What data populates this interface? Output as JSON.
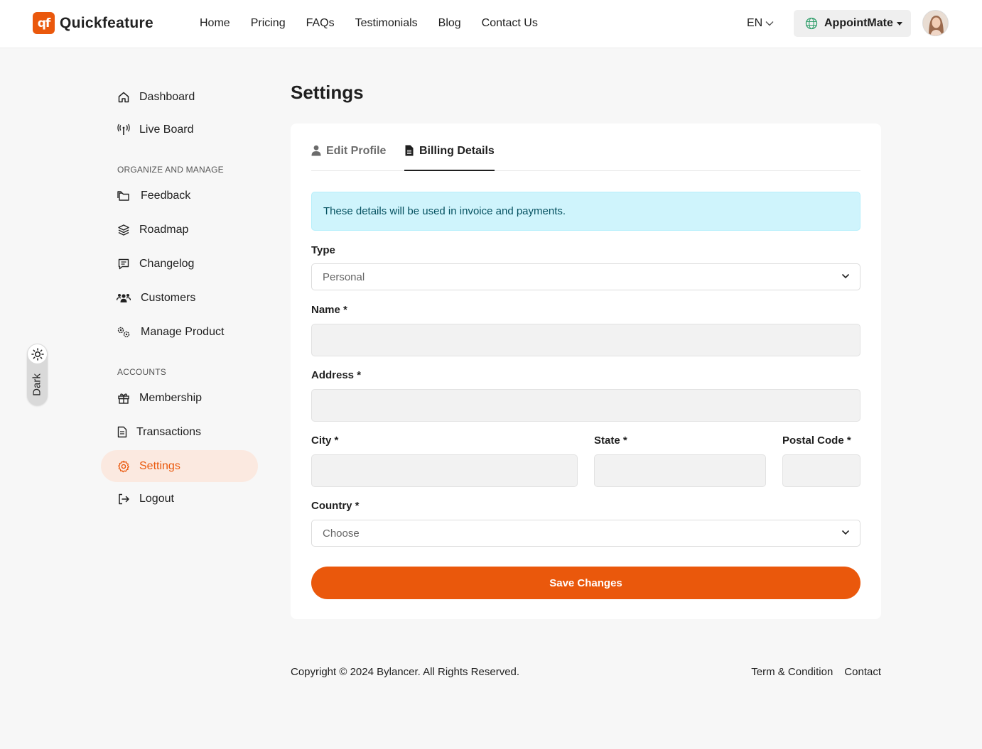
{
  "brand": {
    "logo_mark": "qf",
    "name": "Quickfeature",
    "accent": "#ea580c"
  },
  "nav": [
    "Home",
    "Pricing",
    "FAQs",
    "Testimonials",
    "Blog",
    "Contact Us"
  ],
  "header": {
    "language": "EN",
    "workspace": "AppointMate"
  },
  "sidebar": {
    "top_items": [
      {
        "label": "Dashboard",
        "icon": "home-icon"
      },
      {
        "label": "Live Board",
        "icon": "broadcast-icon"
      }
    ],
    "section_manage": "ORGANIZE AND MANAGE",
    "manage_items": [
      {
        "label": "Feedback",
        "icon": "folders-icon"
      },
      {
        "label": "Roadmap",
        "icon": "layers-icon"
      },
      {
        "label": "Changelog",
        "icon": "message-square-icon"
      },
      {
        "label": "Customers",
        "icon": "users-icon"
      },
      {
        "label": "Manage Product",
        "icon": "gears-icon"
      }
    ],
    "section_accounts": "ACCOUNTS",
    "account_items": [
      {
        "label": "Membership",
        "icon": "gift-icon"
      },
      {
        "label": "Transactions",
        "icon": "file-text-icon"
      },
      {
        "label": "Settings",
        "icon": "settings-icon",
        "active": true
      },
      {
        "label": "Logout",
        "icon": "logout-icon"
      }
    ]
  },
  "theme_toggle": {
    "label": "Dark"
  },
  "main": {
    "title": "Settings",
    "tabs": [
      {
        "label": "Edit Profile",
        "icon": "user-icon",
        "active": false
      },
      {
        "label": "Billing Details",
        "icon": "document-icon",
        "active": true
      }
    ],
    "alert": "These details will be used in invoice and payments.",
    "form": {
      "type_label": "Type",
      "type_value": "Personal",
      "name_label": "Name *",
      "name_value": "",
      "address_label": "Address *",
      "address_value": "",
      "city_label": "City *",
      "city_value": "",
      "state_label": "State *",
      "state_value": "",
      "postal_label": "Postal Code *",
      "postal_value": "",
      "country_label": "Country *",
      "country_value": "Choose"
    },
    "save_label": "Save Changes"
  },
  "footer": {
    "copyright": "Copyright © 2024 Bylancer. All Rights Reserved.",
    "links": [
      "Term & Condition",
      "Contact"
    ]
  }
}
